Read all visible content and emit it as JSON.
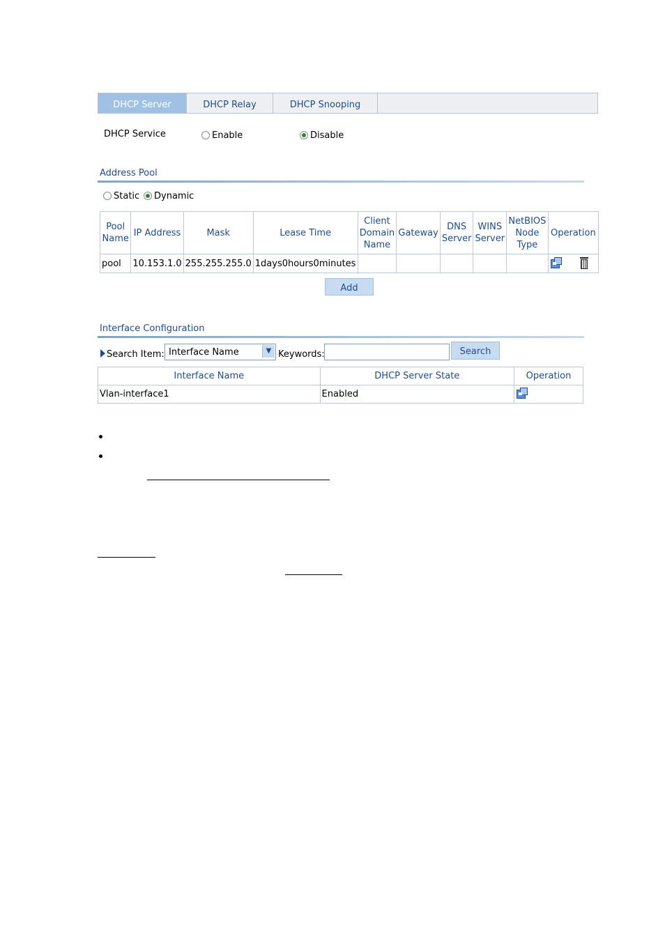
{
  "tabs": [
    {
      "label": "DHCP Server",
      "active": true
    },
    {
      "label": "DHCP Relay",
      "active": false
    },
    {
      "label": "DHCP Snooping",
      "active": false
    }
  ],
  "dhcp_service": {
    "label": "DHCP Service",
    "enable_label": "Enable",
    "disable_label": "Disable",
    "selected": "Disable"
  },
  "address_pool": {
    "title": "Address Pool",
    "static_label": "Static",
    "dynamic_label": "Dynamic",
    "selected": "Dynamic",
    "headers": [
      "Pool Name",
      "IP Address",
      "Mask",
      "Lease Time",
      "Client Domain Name",
      "Gateway",
      "DNS Server",
      "WINS Server",
      "NetBIOS Node Type",
      "Operation"
    ],
    "rows": [
      {
        "pool_name": "pool",
        "ip_address": "10.153.1.0",
        "mask": "255.255.255.0",
        "lease_time": "1days0hours0minutes",
        "client_domain": "",
        "gateway": "",
        "dns": "",
        "wins": "",
        "netbios": ""
      }
    ],
    "add_label": "Add"
  },
  "interface_config": {
    "title": "Interface Configuration",
    "search_item_label": "Search Item:",
    "search_item_value": "Interface Name",
    "keywords_label": "Keywords:",
    "keywords_value": "",
    "search_label": "Search",
    "headers": [
      "Interface Name",
      "DHCP Server State",
      "Operation"
    ],
    "rows": [
      {
        "interface": "Vlan-interface1",
        "state": "Enabled"
      }
    ]
  },
  "icons": {
    "edit": "edit-icon",
    "delete": "trash-icon",
    "search_arrow": "triangle-right-icon",
    "dropdown": "chevron-down-icon"
  },
  "colors": {
    "accent": "#1e4d8c",
    "active_tab": "#9fc1e3",
    "button": "#c7dcf1"
  }
}
